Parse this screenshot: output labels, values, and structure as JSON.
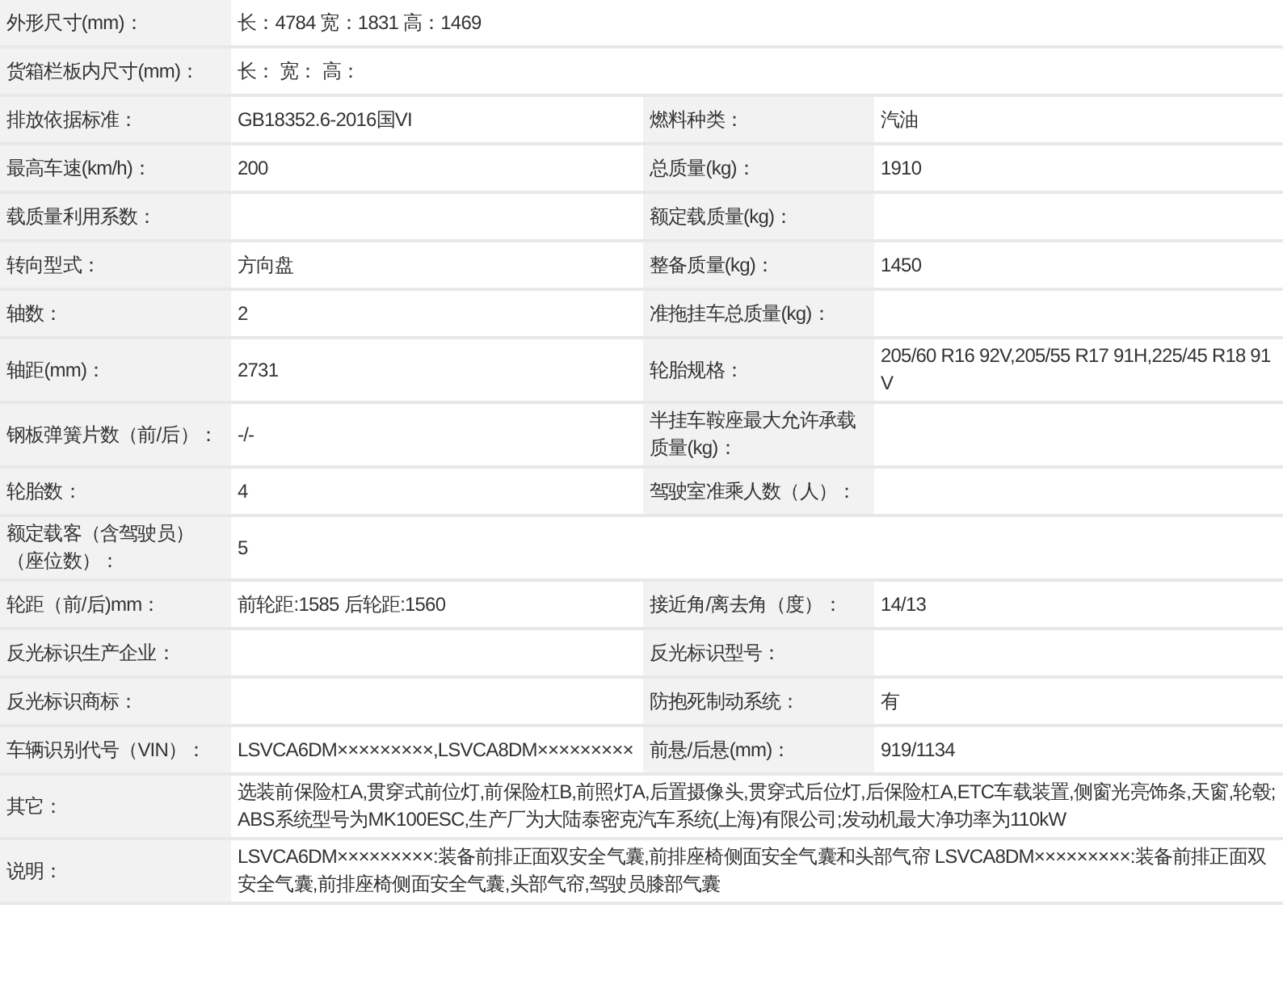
{
  "rows": [
    {
      "kind": "wide",
      "label": "外形尺寸(mm)：",
      "value": "长：4784 宽：1831 高：1469"
    },
    {
      "kind": "wide",
      "label": "货箱栏板内尺寸(mm)：",
      "value": "长： 宽： 高："
    },
    {
      "kind": "pair",
      "label": "排放依据标准：",
      "value": "GB18352.6-2016国VI",
      "label2": "燃料种类：",
      "value2": "汽油"
    },
    {
      "kind": "pair",
      "label": "最高车速(km/h)：",
      "value": "200",
      "label2": "总质量(kg)：",
      "value2": "1910"
    },
    {
      "kind": "pair",
      "label": "载质量利用系数：",
      "label2": "额定载质量(kg)："
    },
    {
      "kind": "pair",
      "label": "转向型式：",
      "value": "方向盘",
      "label2": "整备质量(kg)：",
      "value2": "1450"
    },
    {
      "kind": "pair",
      "label": "轴数：",
      "value": "2",
      "label2": "准拖挂车总质量(kg)："
    },
    {
      "kind": "pair",
      "label": "轴距(mm)：",
      "value": "2731",
      "label2": "轮胎规格：",
      "value2": "205/60 R16 92V,205/55 R17 91H,225/45 R18 91V"
    },
    {
      "kind": "pair",
      "label": "钢板弹簧片数（前/后）：",
      "value": "-/-",
      "label2": "半挂车鞍座最大允许承载质量(kg)："
    },
    {
      "kind": "pair",
      "label": "轮胎数：",
      "value": "4",
      "label2": "驾驶室准乘人数（人）："
    },
    {
      "kind": "half",
      "label": "额定载客（含驾驶员）（座位数）：",
      "value": "5"
    },
    {
      "kind": "pair",
      "label": "轮距（前/后)mm：",
      "value": "前轮距:1585 后轮距:1560",
      "label2": "接近角/离去角（度）：",
      "value2": "14/13"
    },
    {
      "kind": "pair",
      "label": "反光标识生产企业：",
      "label2": "反光标识型号："
    },
    {
      "kind": "pair",
      "label": "反光标识商标：",
      "label2": "防抱死制动系统：",
      "value2": "有"
    },
    {
      "kind": "pair",
      "label": "车辆识别代号（VIN）：",
      "value": "LSVCA6DM×××××××××,LSVCA8DM×××××××××",
      "label2": "前悬/后悬(mm)：",
      "value2": "919/1134"
    },
    {
      "kind": "wide",
      "label": "其它：",
      "value": "选装前保险杠A,贯穿式前位灯,前保险杠B,前照灯A,后置摄像头,贯穿式后位灯,后保险杠A,ETC车载装置,侧窗光亮饰条,天窗,轮毂;ABS系统型号为MK100ESC,生产厂为大陆泰密克汽车系统(上海)有限公司;发动机最大净功率为110kW"
    },
    {
      "kind": "wide",
      "label": "说明：",
      "value": "LSVCA6DM×××××××××:装备前排正面双安全气囊,前排座椅侧面安全气囊和头部气帘 LSVCA8DM×××××××××:装备前排正面双安全气囊,前排座椅侧面安全气囊,头部气帘,驾驶员膝部气囊"
    }
  ]
}
